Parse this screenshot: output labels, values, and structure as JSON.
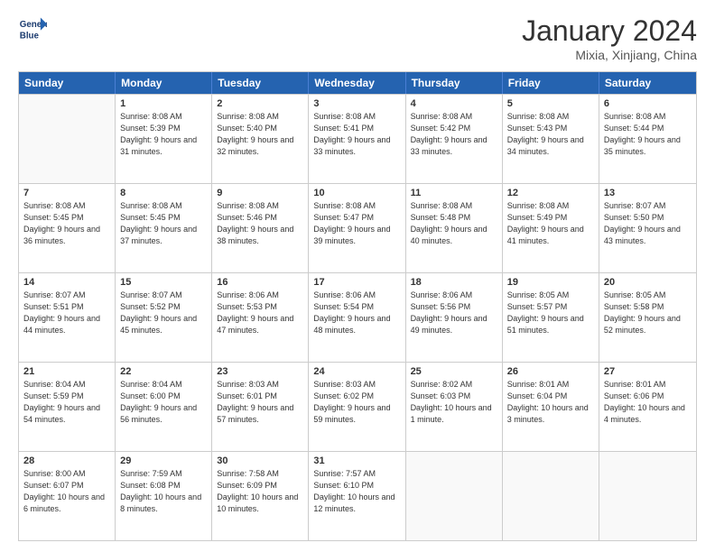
{
  "logo": {
    "line1": "General",
    "line2": "Blue"
  },
  "title": "January 2024",
  "location": "Mixia, Xinjiang, China",
  "weekdays": [
    "Sunday",
    "Monday",
    "Tuesday",
    "Wednesday",
    "Thursday",
    "Friday",
    "Saturday"
  ],
  "weeks": [
    [
      {
        "day": "",
        "sunrise": "",
        "sunset": "",
        "daylight": ""
      },
      {
        "day": "1",
        "sunrise": "Sunrise: 8:08 AM",
        "sunset": "Sunset: 5:39 PM",
        "daylight": "Daylight: 9 hours and 31 minutes."
      },
      {
        "day": "2",
        "sunrise": "Sunrise: 8:08 AM",
        "sunset": "Sunset: 5:40 PM",
        "daylight": "Daylight: 9 hours and 32 minutes."
      },
      {
        "day": "3",
        "sunrise": "Sunrise: 8:08 AM",
        "sunset": "Sunset: 5:41 PM",
        "daylight": "Daylight: 9 hours and 33 minutes."
      },
      {
        "day": "4",
        "sunrise": "Sunrise: 8:08 AM",
        "sunset": "Sunset: 5:42 PM",
        "daylight": "Daylight: 9 hours and 33 minutes."
      },
      {
        "day": "5",
        "sunrise": "Sunrise: 8:08 AM",
        "sunset": "Sunset: 5:43 PM",
        "daylight": "Daylight: 9 hours and 34 minutes."
      },
      {
        "day": "6",
        "sunrise": "Sunrise: 8:08 AM",
        "sunset": "Sunset: 5:44 PM",
        "daylight": "Daylight: 9 hours and 35 minutes."
      }
    ],
    [
      {
        "day": "7",
        "sunrise": "Sunrise: 8:08 AM",
        "sunset": "Sunset: 5:45 PM",
        "daylight": "Daylight: 9 hours and 36 minutes."
      },
      {
        "day": "8",
        "sunrise": "Sunrise: 8:08 AM",
        "sunset": "Sunset: 5:45 PM",
        "daylight": "Daylight: 9 hours and 37 minutes."
      },
      {
        "day": "9",
        "sunrise": "Sunrise: 8:08 AM",
        "sunset": "Sunset: 5:46 PM",
        "daylight": "Daylight: 9 hours and 38 minutes."
      },
      {
        "day": "10",
        "sunrise": "Sunrise: 8:08 AM",
        "sunset": "Sunset: 5:47 PM",
        "daylight": "Daylight: 9 hours and 39 minutes."
      },
      {
        "day": "11",
        "sunrise": "Sunrise: 8:08 AM",
        "sunset": "Sunset: 5:48 PM",
        "daylight": "Daylight: 9 hours and 40 minutes."
      },
      {
        "day": "12",
        "sunrise": "Sunrise: 8:08 AM",
        "sunset": "Sunset: 5:49 PM",
        "daylight": "Daylight: 9 hours and 41 minutes."
      },
      {
        "day": "13",
        "sunrise": "Sunrise: 8:07 AM",
        "sunset": "Sunset: 5:50 PM",
        "daylight": "Daylight: 9 hours and 43 minutes."
      }
    ],
    [
      {
        "day": "14",
        "sunrise": "Sunrise: 8:07 AM",
        "sunset": "Sunset: 5:51 PM",
        "daylight": "Daylight: 9 hours and 44 minutes."
      },
      {
        "day": "15",
        "sunrise": "Sunrise: 8:07 AM",
        "sunset": "Sunset: 5:52 PM",
        "daylight": "Daylight: 9 hours and 45 minutes."
      },
      {
        "day": "16",
        "sunrise": "Sunrise: 8:06 AM",
        "sunset": "Sunset: 5:53 PM",
        "daylight": "Daylight: 9 hours and 47 minutes."
      },
      {
        "day": "17",
        "sunrise": "Sunrise: 8:06 AM",
        "sunset": "Sunset: 5:54 PM",
        "daylight": "Daylight: 9 hours and 48 minutes."
      },
      {
        "day": "18",
        "sunrise": "Sunrise: 8:06 AM",
        "sunset": "Sunset: 5:56 PM",
        "daylight": "Daylight: 9 hours and 49 minutes."
      },
      {
        "day": "19",
        "sunrise": "Sunrise: 8:05 AM",
        "sunset": "Sunset: 5:57 PM",
        "daylight": "Daylight: 9 hours and 51 minutes."
      },
      {
        "day": "20",
        "sunrise": "Sunrise: 8:05 AM",
        "sunset": "Sunset: 5:58 PM",
        "daylight": "Daylight: 9 hours and 52 minutes."
      }
    ],
    [
      {
        "day": "21",
        "sunrise": "Sunrise: 8:04 AM",
        "sunset": "Sunset: 5:59 PM",
        "daylight": "Daylight: 9 hours and 54 minutes."
      },
      {
        "day": "22",
        "sunrise": "Sunrise: 8:04 AM",
        "sunset": "Sunset: 6:00 PM",
        "daylight": "Daylight: 9 hours and 56 minutes."
      },
      {
        "day": "23",
        "sunrise": "Sunrise: 8:03 AM",
        "sunset": "Sunset: 6:01 PM",
        "daylight": "Daylight: 9 hours and 57 minutes."
      },
      {
        "day": "24",
        "sunrise": "Sunrise: 8:03 AM",
        "sunset": "Sunset: 6:02 PM",
        "daylight": "Daylight: 9 hours and 59 minutes."
      },
      {
        "day": "25",
        "sunrise": "Sunrise: 8:02 AM",
        "sunset": "Sunset: 6:03 PM",
        "daylight": "Daylight: 10 hours and 1 minute."
      },
      {
        "day": "26",
        "sunrise": "Sunrise: 8:01 AM",
        "sunset": "Sunset: 6:04 PM",
        "daylight": "Daylight: 10 hours and 3 minutes."
      },
      {
        "day": "27",
        "sunrise": "Sunrise: 8:01 AM",
        "sunset": "Sunset: 6:06 PM",
        "daylight": "Daylight: 10 hours and 4 minutes."
      }
    ],
    [
      {
        "day": "28",
        "sunrise": "Sunrise: 8:00 AM",
        "sunset": "Sunset: 6:07 PM",
        "daylight": "Daylight: 10 hours and 6 minutes."
      },
      {
        "day": "29",
        "sunrise": "Sunrise: 7:59 AM",
        "sunset": "Sunset: 6:08 PM",
        "daylight": "Daylight: 10 hours and 8 minutes."
      },
      {
        "day": "30",
        "sunrise": "Sunrise: 7:58 AM",
        "sunset": "Sunset: 6:09 PM",
        "daylight": "Daylight: 10 hours and 10 minutes."
      },
      {
        "day": "31",
        "sunrise": "Sunrise: 7:57 AM",
        "sunset": "Sunset: 6:10 PM",
        "daylight": "Daylight: 10 hours and 12 minutes."
      },
      {
        "day": "",
        "sunrise": "",
        "sunset": "",
        "daylight": ""
      },
      {
        "day": "",
        "sunrise": "",
        "sunset": "",
        "daylight": ""
      },
      {
        "day": "",
        "sunrise": "",
        "sunset": "",
        "daylight": ""
      }
    ]
  ]
}
